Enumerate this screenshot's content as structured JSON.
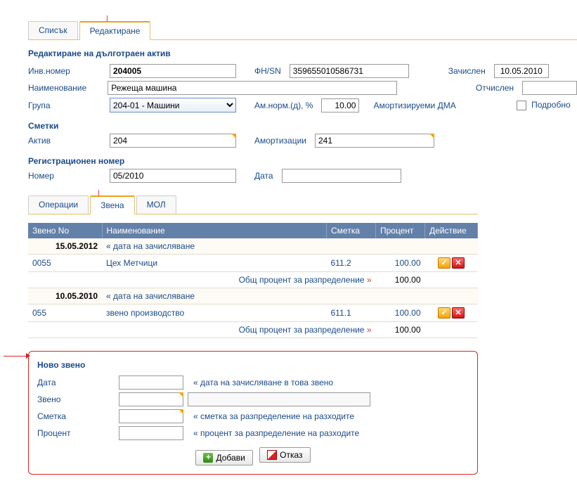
{
  "tabs_main": {
    "list": "Списък",
    "edit": "Редактиране"
  },
  "title": "Редактиране на дълготраен актив",
  "labels": {
    "inv_no": "Инв.номер",
    "fnsn": "ФН/SN",
    "registered": "Зачислен",
    "name": "Наименование",
    "deregistered": "Отчислен",
    "group": "Група",
    "am_norm": "Ам.норм.(д), %",
    "depreciable": "Амортизируеми ДМА",
    "detail": "Подробно",
    "accounts": "Сметки",
    "active_acc": "Актив",
    "dep_acc": "Амортизации",
    "reg_no": "Регистрационен номер",
    "number": "Номер",
    "date": "Дата"
  },
  "values": {
    "inv_no": "204005",
    "fnsn": "359655010586731",
    "registered": "10.05.2010",
    "name": "Режеща машина",
    "deregistered": "",
    "group": "204-01 - Машини",
    "am_norm": "10.00",
    "active_acc": "204",
    "dep_acc": "241",
    "number": "05/2010",
    "date2": ""
  },
  "subtabs": {
    "ops": "Операции",
    "units": "Звена",
    "mol": "МОЛ"
  },
  "grid": {
    "cols": {
      "unit_no": "Звено No",
      "name": "Наименование",
      "account": "Сметка",
      "percent": "Процент",
      "action": "Действие"
    },
    "date_hint": "« дата на зачисляване",
    "total_label": "Общ процент за разпределение »",
    "groups": [
      {
        "date": "15.05.2012",
        "rows": [
          {
            "unit_no": "0055",
            "name": "Цех Метчици",
            "account": "611.2",
            "percent": "100.00"
          }
        ],
        "total": "100.00"
      },
      {
        "date": "10.05.2010",
        "rows": [
          {
            "unit_no": "055",
            "name": "звено производство",
            "account": "611.1",
            "percent": "100.00"
          }
        ],
        "total": "100.00"
      }
    ]
  },
  "newunit": {
    "title": "Ново звено",
    "labels": {
      "date": "Дата",
      "unit": "Звено",
      "account": "Сметка",
      "percent": "Процент"
    },
    "hints": {
      "date": "« дата на зачисляване в това звено",
      "account": "« сметка за разпределение на разходите",
      "percent": "« процент за разпределение на разходите"
    },
    "buttons": {
      "add": "Добави",
      "cancel": "Отказ"
    }
  }
}
